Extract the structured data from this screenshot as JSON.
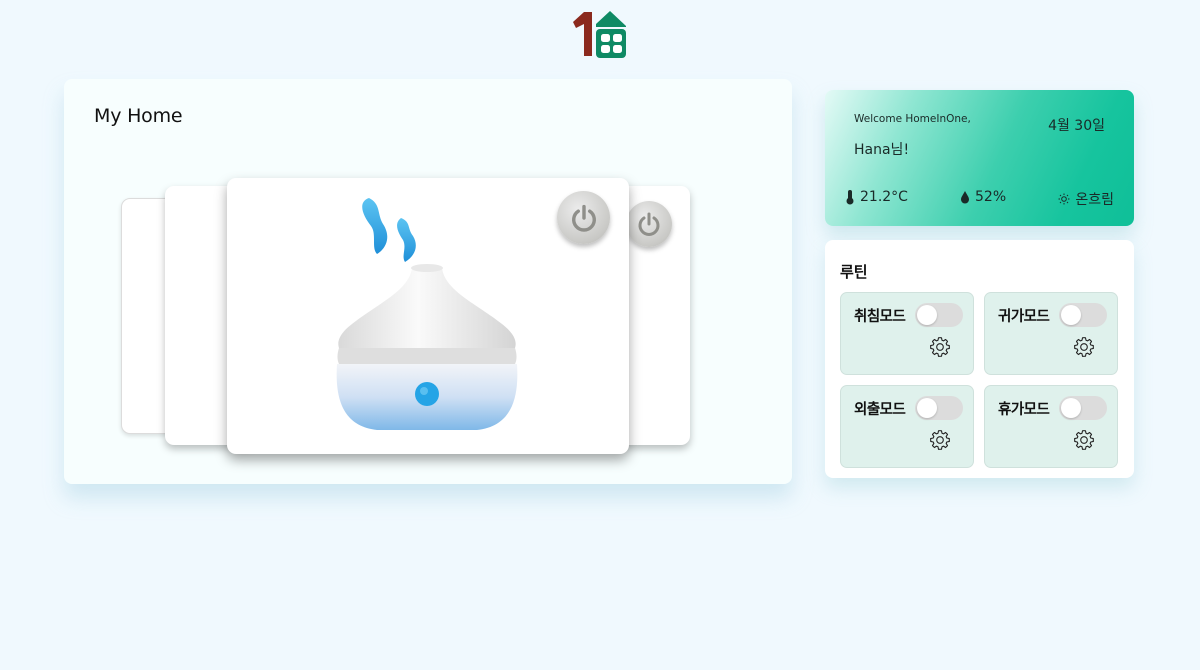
{
  "brand": {
    "logo": "homeinone-logo"
  },
  "my_home": {
    "title": "My Home",
    "device": {
      "icon": "humidifier-icon",
      "power_icon": "power-icon"
    }
  },
  "welcome": {
    "greeting": "Welcome HomeInOne,",
    "date": "4월 30일",
    "user": "Hana님!",
    "temperature": "21.2°C",
    "humidity": "52%",
    "weather": "온흐림",
    "icons": {
      "temperature": "thermometer-icon",
      "humidity": "droplet-icon",
      "weather": "sun-icon"
    },
    "colors": {
      "accent": "#0fbf98"
    }
  },
  "routine": {
    "title": "루틴",
    "modes": [
      {
        "label": "취침모드",
        "enabled": false
      },
      {
        "label": "귀가모드",
        "enabled": false
      },
      {
        "label": "외출모드",
        "enabled": false
      },
      {
        "label": "휴가모드",
        "enabled": false
      }
    ]
  }
}
